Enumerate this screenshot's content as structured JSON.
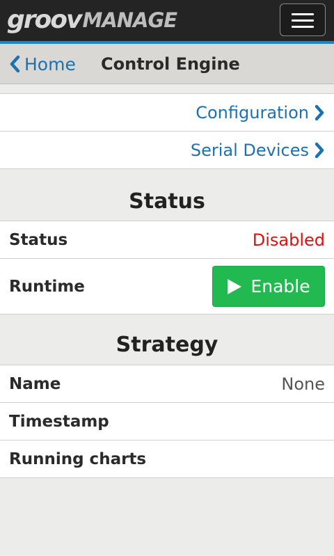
{
  "app": {
    "logo_primary": "groov",
    "logo_secondary": "MANAGE"
  },
  "navbar": {
    "back_label": "Home",
    "title": "Control Engine"
  },
  "links": [
    {
      "label": "Configuration"
    },
    {
      "label": "Serial Devices"
    }
  ],
  "status_section": {
    "heading": "Status",
    "status_label": "Status",
    "status_value": "Disabled",
    "status_color": "#e30e0e",
    "runtime_label": "Runtime",
    "enable_button_label": "Enable",
    "enable_button_color": "#22b950"
  },
  "strategy_section": {
    "heading": "Strategy",
    "name_label": "Name",
    "name_value": "None",
    "timestamp_label": "Timestamp",
    "running_charts_label": "Running charts"
  },
  "icons": {
    "menu": "hamburger-icon",
    "back": "chevron-left-icon",
    "forward": "chevron-right-icon",
    "play": "play-icon"
  },
  "colors": {
    "accent": "#1d86c8",
    "link": "#1c72b0",
    "topbar": "#242424"
  }
}
